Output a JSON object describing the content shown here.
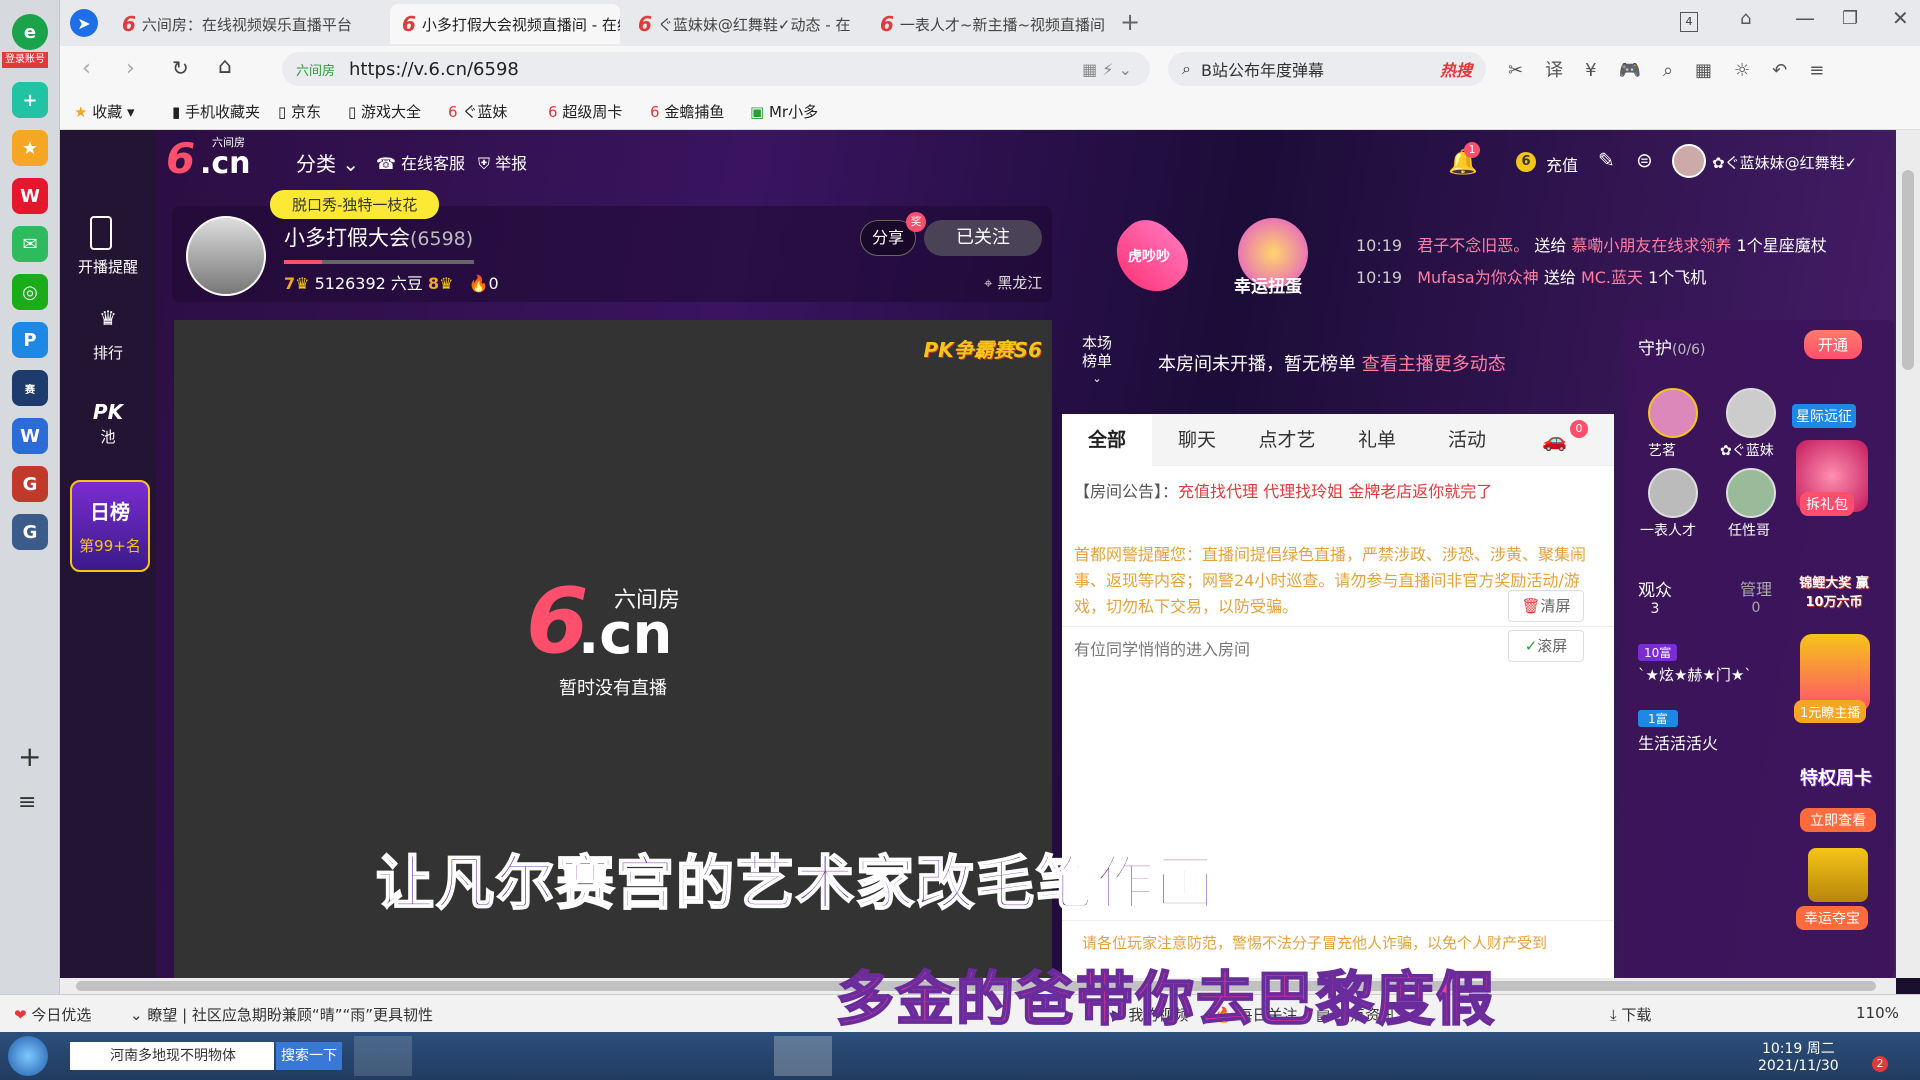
{
  "browser": {
    "login_label": "登录账号",
    "tabs": [
      {
        "title": "六间房：在线视频娱乐直播平台"
      },
      {
        "title": "小多打假大会视频直播间 - 在线"
      },
      {
        "title": "ぐ蓝妹妹@红舞鞋✓动态 - 在"
      },
      {
        "title": "一表人才~新主播~视频直播间"
      }
    ],
    "tab_count": "4",
    "url_site_tag": "六间房",
    "url": "https://v.6.cn/6598",
    "search_text": "B站公布年度弹幕",
    "search_hot": "热搜",
    "bookmarks": [
      "收藏",
      "手机收藏夹",
      "京东",
      "游戏大全",
      "ぐ蓝妹",
      "超级周卡",
      "金蟾捕鱼",
      "Mr小多"
    ]
  },
  "site": {
    "logo_text": ".cn",
    "logo_sub": "六间房",
    "category": "分类",
    "customer_service": "在线客服",
    "report": "举报",
    "notice_badge": "1",
    "recharge": "充值",
    "username": "✿ぐ蓝妹妹@红舞鞋✓",
    "sidebar": {
      "remind": "开播提醒",
      "rank": "排行",
      "pk": "PK",
      "pool": "池",
      "daily": "日榜",
      "daily_rank": "第99+名"
    }
  },
  "anchor": {
    "tag": "脱口秀-独特一枝花",
    "name": "小多打假大会",
    "room": "(6598)",
    "level_left": "7",
    "beans": "5126392 六豆",
    "level_right": "8",
    "fire": "0",
    "share": "分享",
    "share_badge": "奖",
    "followed": "已关注",
    "location": "黑龙江",
    "promo1": "虎吵吵",
    "promo2": "幸运扭蛋",
    "feed": [
      {
        "time": "10:19",
        "text1": "君子不念旧恶。",
        "mid": "送给",
        "text2": "慕嘞小朋友在线求领养",
        "gift": "1个星座魔杖"
      },
      {
        "time": "10:19",
        "text1": "Mufasa为你众神",
        "mid": "送给",
        "text2": "MC.蓝天",
        "gift": "1个飞机"
      }
    ]
  },
  "player": {
    "pk_badge": "PK争霸赛S6",
    "logo_main": ".cn",
    "logo_sub": "六间房",
    "message": "暂时没有直播"
  },
  "rank": {
    "label_line1": "本场",
    "label_line2": "榜单",
    "no_rank": "本房间未开播，暂无榜单",
    "more_link": "查看主播更多动态"
  },
  "chat": {
    "tabs": [
      "全部",
      "聊天",
      "点才艺",
      "礼单",
      "活动"
    ],
    "car_badge": "0",
    "announce_label": "【房间公告】：",
    "announce": "充值找代理 代理找玲姐 金牌老店返你就完了",
    "warning": "首都网警提醒您：直播间提倡绿色直播，严禁涉政、涉恐、涉黄、聚集闹事、返现等内容；网警24小时巡查。请勿参与直播间非官方奖励活动/游戏，切勿私下交易，以防受骗。",
    "clear": "清屏",
    "enter": "有位同学悄悄的进入房间",
    "scroll": "滚屏",
    "bottom_notice": "请各位玩家注意防范，警惕不法分子冒充他人诈骗，以免个人财产受到"
  },
  "guard": {
    "title": "守护",
    "count": "(0/6)",
    "open": "开通",
    "members": [
      "艺茗",
      "✿ぐ蓝妹",
      "一表人才",
      "任性哥"
    ],
    "audience": "观众",
    "audience_n": "3",
    "admin": "管理",
    "admin_n": "0",
    "viewers": [
      {
        "badge": "10富",
        "name": "`★炫★赫★门★`"
      },
      {
        "badge": "1富",
        "name": "生活活活火"
      }
    ],
    "promos": [
      "星际远征",
      "拆礼包",
      "锦鲤大奖 赢10万六币",
      "1元瞭主播",
      "特权周卡",
      "立即查看",
      "幸运夺宝"
    ]
  },
  "subtitles": {
    "line1": "让凡尔赛宫的艺术家改毛笔作画",
    "line2": "多金的爸带你去巴黎度假"
  },
  "statusbar": {
    "left": "今日优选",
    "news": "瞭望 | 社区应急期盼兼顾“晴”“雨”更具韧性",
    "my_video": "我的视频",
    "daily": "每日关注",
    "hot": "热点资讯",
    "download": "下载",
    "zoom": "110%"
  },
  "taskbar": {
    "search_text": "河南多地现不明物体",
    "search_btn": "搜索一下",
    "time": "10:19 周二",
    "date": "2021/11/30",
    "notify": "2"
  },
  "colors": {
    "pink": "#ff4f6d",
    "gold": "#f5c518",
    "purple": "#6a2c9c"
  }
}
